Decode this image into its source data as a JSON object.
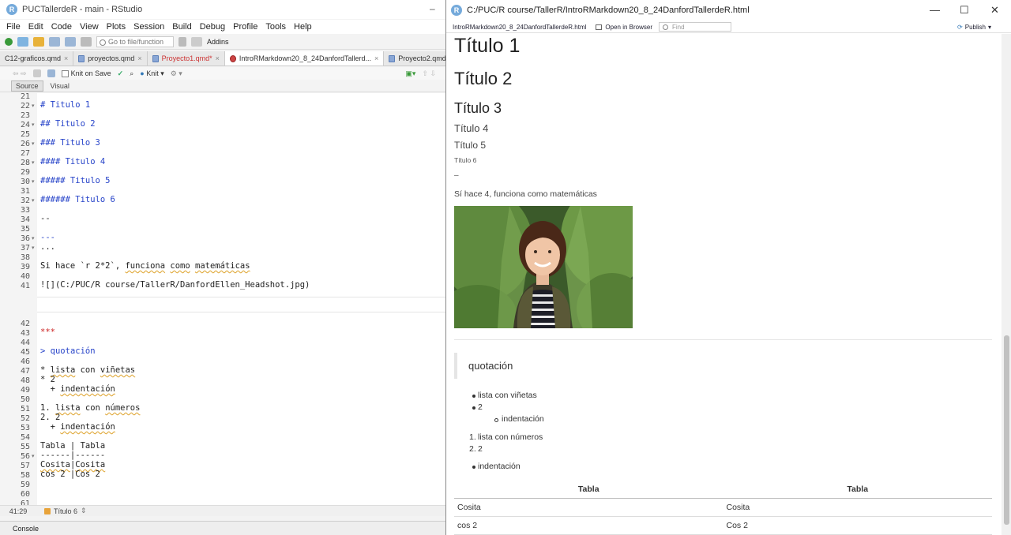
{
  "rstudio": {
    "title": "PUCTallerdeR - main - RStudio",
    "menu": [
      "File",
      "Edit",
      "Code",
      "View",
      "Plots",
      "Session",
      "Build",
      "Debug",
      "Profile",
      "Tools",
      "Help"
    ],
    "toolbar": {
      "goto_placeholder": "Go to file/function",
      "addins": "Addins"
    },
    "tabs": [
      "C12-graficos.qmd",
      "proyectos.qmd",
      "Proyecto1.qmd*",
      "IntroRMarkdown20_8_24DanfordTallerd...",
      "Proyecto2.qmd"
    ],
    "editor_toolbar": {
      "knit_on_save": "Knit on Save",
      "knit": "Knit"
    },
    "source_visual": {
      "source": "Source",
      "visual": "Visual"
    },
    "lines": {
      "l21": "21",
      "l22": "22",
      "l23": "23",
      "l24": "24",
      "l25": "25",
      "l26": "26",
      "l27": "27",
      "l28": "28",
      "l29": "29",
      "l30": "30",
      "l31": "31",
      "l32": "32",
      "l33": "33",
      "l34": "34",
      "l35": "35",
      "l36": "36",
      "l37": "37",
      "l38": "38",
      "l39": "39",
      "l40": "40",
      "l41": "41",
      "l42": "42",
      "l43": "43",
      "l44": "44",
      "l45": "45",
      "l46": "46",
      "l47": "47",
      "l48": "48",
      "l49": "49",
      "l50": "50",
      "l51": "51",
      "l52": "52",
      "l53": "53",
      "l54": "54",
      "l55": "55",
      "l56": "56",
      "l57": "57",
      "l58": "58",
      "l59": "59",
      "l60": "60",
      "l61": "61"
    },
    "code": {
      "c22": "# Titulo 1",
      "c24": "## Titulo 2",
      "c26": "### Titulo 3",
      "c28": "#### Titulo 4",
      "c30": "##### Titulo 5",
      "c32": "###### Titulo 6",
      "c34": "--",
      "c36": "---",
      "c37": "...",
      "c39a": "Si hace `r 2*2`, ",
      "c39b": "funciona",
      "c39c": " ",
      "c39d": "como",
      "c39e": " ",
      "c39f": "matemáticas",
      "c41": "![](C:/PUC/R course/TallerR/DanfordEllen_Headshot.jpg)",
      "c43": "***",
      "c45a": "> ",
      "c45b": "quotación",
      "c47a": "* ",
      "c47b": "lista",
      "c47c": " con ",
      "c47d": "viñetas",
      "c48": "* 2",
      "c49a": "  + ",
      "c49b": "indentación",
      "c51a": "1. ",
      "c51b": "lista",
      "c51c": " con ",
      "c51d": "números",
      "c52": "2. 2",
      "c53a": "  + ",
      "c53b": "indentación",
      "c55": "Tabla | Tabla",
      "c56": "------|------",
      "c57a": "Cosita",
      "c57b": "|",
      "c57c": "Cosita",
      "c58": "cos 2 |Cos 2"
    },
    "status": {
      "position": "41:29",
      "section": "Título 6"
    },
    "console": "Console"
  },
  "viewer": {
    "title": "C:/PUC/R course/TallerR/IntroRMarkdown20_8_24DanfordTallerdeR.html",
    "file": "IntroRMarkdown20_8_24DanfordTallerdeR.html",
    "open_browser": "Open in Browser",
    "find_placeholder": "Find",
    "publish": "Publish",
    "h1": "Título 1",
    "h2": "Título 2",
    "h3": "Título 3",
    "h4": "Título 4",
    "h5": "Título 5",
    "h6": "Título 6",
    "dash": "–",
    "sentence": "Sí hace 4, funciona como matemáticas",
    "quote": "quotación",
    "bullets": [
      "lista con viñetas",
      "2"
    ],
    "sub_bullet": "indentación",
    "numbered": [
      {
        "n": "1.",
        "t": "lista con números"
      },
      {
        "n": "2.",
        "t": "2"
      }
    ],
    "after_bullet": "indentación",
    "table": {
      "headers": [
        "Tabla",
        "Tabla"
      ],
      "rows": [
        [
          "Cosita",
          "Cosita"
        ],
        [
          "cos 2",
          "Cos 2"
        ]
      ]
    }
  },
  "colors": {
    "heading": "#2643c9",
    "rstudio_blue": "#75aadb",
    "rule_red": "#cc2222"
  }
}
